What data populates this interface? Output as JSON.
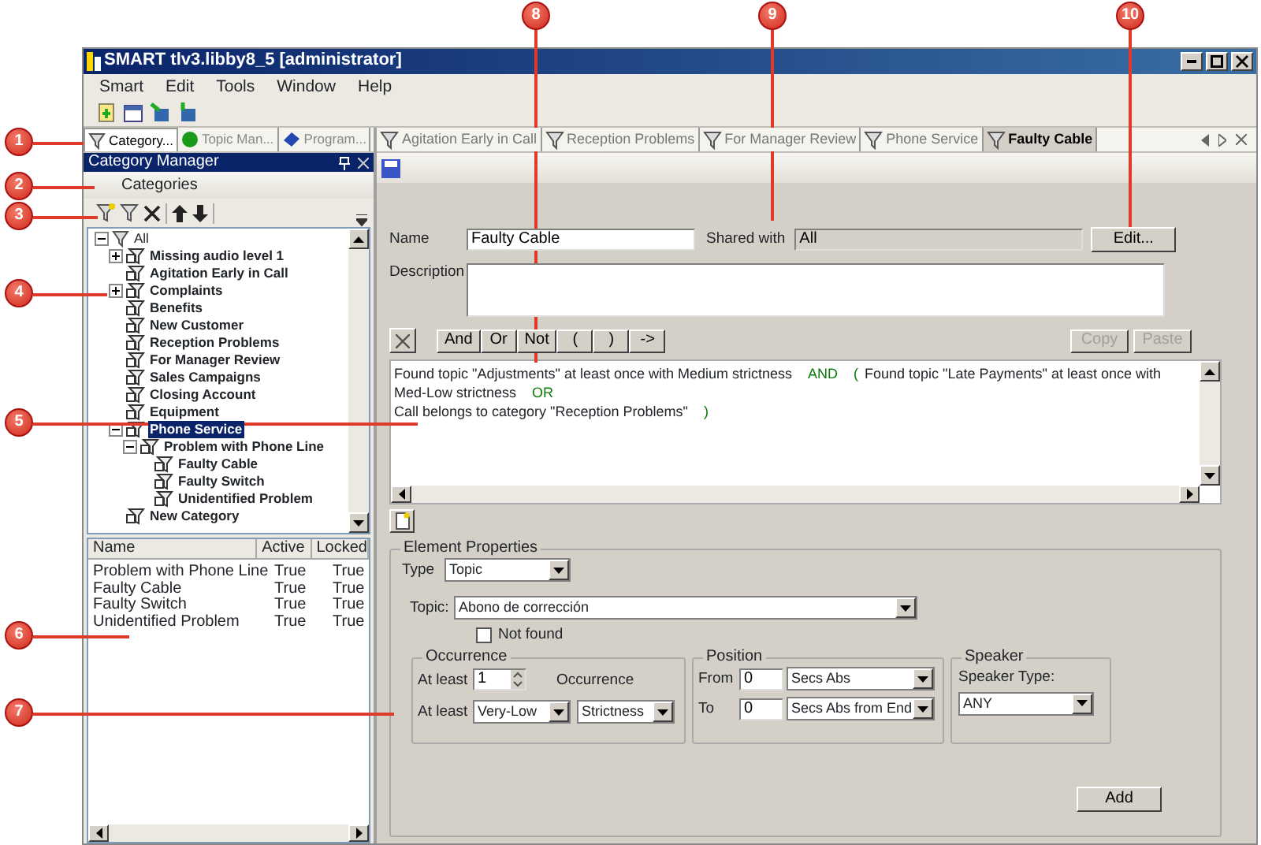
{
  "callouts": [
    "1",
    "2",
    "3",
    "4",
    "5",
    "6",
    "7",
    "8",
    "9",
    "10"
  ],
  "window": {
    "title": "SMART tlv3.libby8_5 [administrator]"
  },
  "menu": [
    "Smart",
    "Edit",
    "Tools",
    "Window",
    "Help"
  ],
  "left_pane": {
    "tabs": [
      {
        "label": "Category...",
        "selected": true
      },
      {
        "label": "Topic Man...",
        "selected": false
      },
      {
        "label": "Program...",
        "selected": false
      }
    ],
    "panel_title": "Category Manager",
    "section": "Categories",
    "tree": {
      "label": "All",
      "expanded": true,
      "selected": false,
      "children": [
        {
          "label": "Missing audio level 1",
          "expanded": false,
          "selected": false
        },
        {
          "label": "Agitation Early in Call",
          "selected": false
        },
        {
          "label": "Complaints",
          "expanded": false,
          "selected": false
        },
        {
          "label": "Benefits",
          "selected": false
        },
        {
          "label": "New Customer",
          "selected": false
        },
        {
          "label": "Reception Problems",
          "selected": false
        },
        {
          "label": "For Manager Review",
          "selected": false
        },
        {
          "label": "Sales Campaigns",
          "selected": false
        },
        {
          "label": "Closing Account",
          "selected": false
        },
        {
          "label": "Equipment",
          "selected": false
        },
        {
          "label": "Phone Service",
          "expanded": true,
          "selected": true,
          "children": [
            {
              "label": "Problem with Phone Line",
              "expanded": true,
              "selected": false,
              "children": [
                {
                  "label": "Faulty Cable",
                  "selected": false
                },
                {
                  "label": "Faulty Switch",
                  "selected": false
                },
                {
                  "label": "Unidentified Problem",
                  "selected": false
                }
              ]
            }
          ]
        },
        {
          "label": "New Category",
          "selected": false
        }
      ]
    },
    "list": {
      "columns": [
        "Name",
        "Active",
        "Locked"
      ],
      "rows": [
        [
          "Problem with Phone Line",
          "True",
          "True"
        ],
        [
          "Faulty Cable",
          "True",
          "True"
        ],
        [
          "Faulty Switch",
          "True",
          "True"
        ],
        [
          "Unidentified Problem",
          "True",
          "True"
        ]
      ]
    }
  },
  "editor": {
    "tabs": [
      {
        "label": "Agitation Early in Call",
        "selected": false
      },
      {
        "label": "Reception Problems",
        "selected": false
      },
      {
        "label": "For Manager Review",
        "selected": false
      },
      {
        "label": "Phone Service",
        "selected": false
      },
      {
        "label": "Faulty Cable",
        "selected": true
      }
    ],
    "name_label": "Name",
    "name": "Faulty Cable",
    "shared_label": "Shared with",
    "shared": "All",
    "edit_button": "Edit...",
    "description_label": "Description",
    "operators": [
      "And",
      "Or",
      "Not",
      "(",
      ")",
      "->"
    ],
    "copy": {
      "label": "Copy",
      "disabled": true
    },
    "paste": {
      "label": "Paste",
      "disabled": true
    },
    "expression": [
      [
        {
          "kind": "text",
          "text": "Found topic \"Adjustments\" at least once with Medium strictness"
        },
        {
          "kind": "operator",
          "text": "AND"
        },
        {
          "kind": "operator",
          "text": "("
        },
        {
          "kind": "text",
          "text": "Found topic \"Late Payments\" at least once with Med-Low strictness"
        },
        {
          "kind": "operator",
          "text": "OR"
        }
      ],
      [
        {
          "kind": "text",
          "text": "Call belongs to category \"Reception Problems\""
        },
        {
          "kind": "operator",
          "text": ")"
        }
      ]
    ],
    "properties": {
      "title": "Element Properties",
      "type_label": "Type",
      "type": "Topic",
      "topic_label": "Topic:",
      "topic": "Abono de corrección",
      "not_found": {
        "label": "Not found",
        "checked": false
      },
      "occurrence": {
        "title": "Occurrence",
        "at_least_label": "At least",
        "count": "1",
        "count_label": "Occurrence",
        "at_least_label_2": "At least",
        "level": "Very-Low",
        "strictness": "Strictness"
      },
      "position": {
        "title": "Position",
        "from_label": "From",
        "from": "0",
        "from_unit": "Secs Abs",
        "to_label": "To",
        "to": "0",
        "to_unit": "Secs Abs from End"
      },
      "speaker": {
        "title": "Speaker",
        "type_label": "Speaker Type:",
        "type": "ANY"
      },
      "add_button": "Add"
    }
  }
}
